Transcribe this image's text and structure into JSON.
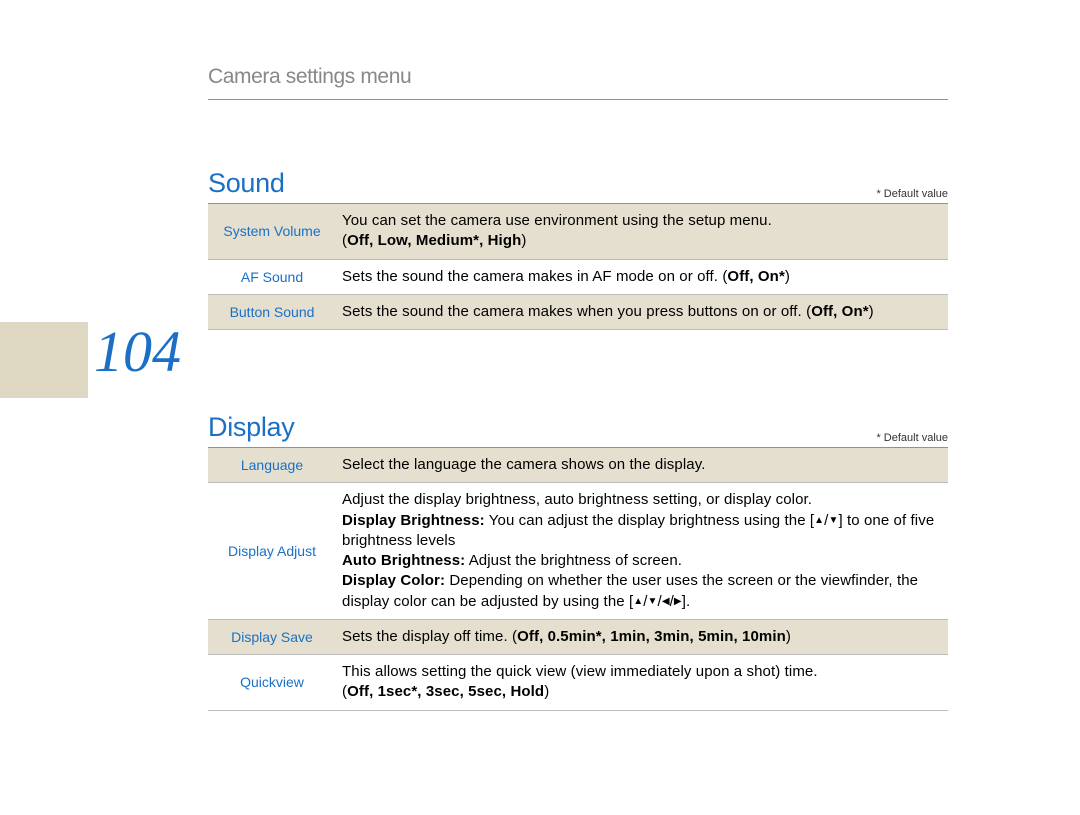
{
  "page_number": "104",
  "breadcrumb": "Camera settings menu",
  "default_value_label": "* Default value",
  "sections": {
    "sound": {
      "title": "Sound",
      "rows": {
        "system_volume": {
          "label": "System Volume",
          "desc_line": "You can set the camera use environment using the setup menu.",
          "options_prefix": "(",
          "options": "Off, Low, Medium*, High",
          "options_suffix": ")"
        },
        "af_sound": {
          "label": "AF Sound",
          "desc_prefix": "Sets the sound the camera makes in AF mode on or off. (",
          "options": "Off, On*",
          "desc_suffix": ")"
        },
        "button_sound": {
          "label": "Button Sound",
          "desc_prefix": "Sets the sound the camera makes when you press buttons on or off. (",
          "options": "Off, On*",
          "desc_suffix": ")"
        }
      }
    },
    "display": {
      "title": "Display",
      "rows": {
        "language": {
          "label": "Language",
          "desc": "Select the language the camera shows on the display."
        },
        "display_adjust": {
          "label": "Display Adjust",
          "line1": "Adjust the display brightness, auto brightness setting, or display color.",
          "bright_label": "Display Brightness:",
          "bright_before": " You can adjust the display brightness using the [",
          "bright_after": "] to one of five brightness levels",
          "auto_label": "Auto Brightness:",
          "auto_desc": " Adjust the brightness of screen.",
          "color_label": "Display Color:",
          "color_before": " Depending on whether the user uses the screen or the viewfinder, the display color can be adjusted by using the [",
          "color_after": "]."
        },
        "display_save": {
          "label": "Display Save",
          "desc_prefix": "Sets the display off time. (",
          "options": "Off, 0.5min*, 1min, 3min, 5min, 10min",
          "desc_suffix": ")"
        },
        "quickview": {
          "label": "Quickview",
          "desc_line": "This allows setting the quick view (view immediately upon a shot) time.",
          "options_prefix": "(",
          "options": "Off, 1sec*, 3sec, 5sec, Hold",
          "options_suffix": ")"
        }
      }
    }
  }
}
